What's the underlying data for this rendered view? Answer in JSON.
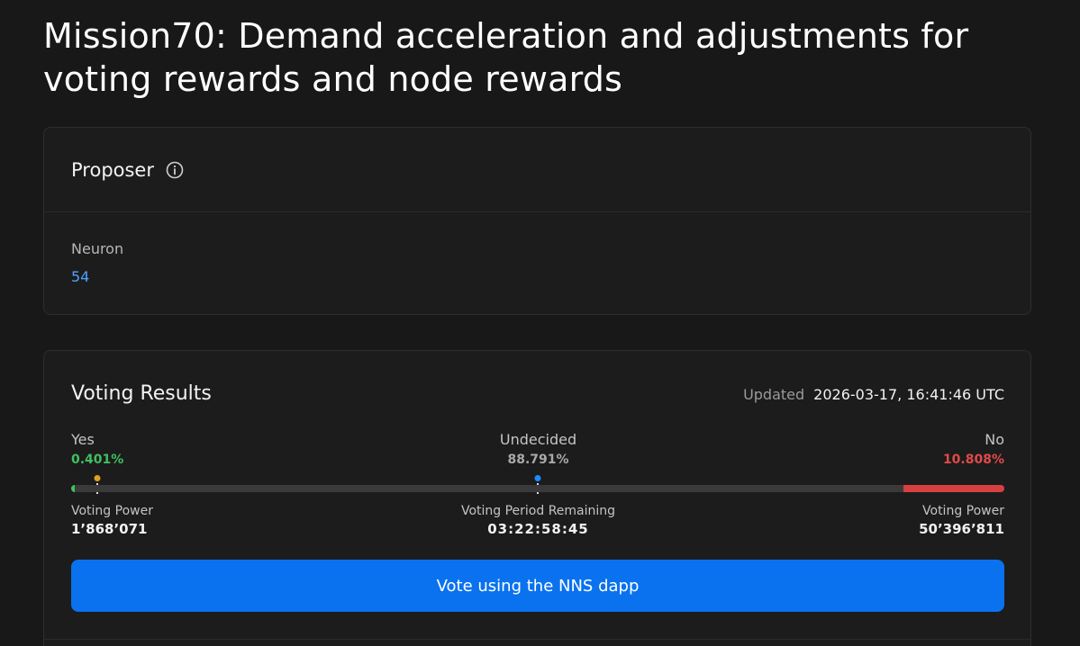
{
  "proposal": {
    "title": "Mission70: Demand acceleration and adjustments for voting rewards and node rewards"
  },
  "proposer": {
    "heading": "Proposer",
    "info_icon": "info-icon",
    "neuron_label": "Neuron",
    "neuron_id": "54"
  },
  "voting": {
    "heading": "Voting Results",
    "updated_label": "Updated",
    "updated_value": "2026-03-17, 16:41:46 UTC",
    "yes_label": "Yes",
    "yes_pct": "0.401%",
    "undecided_label": "Undecided",
    "undecided_pct": "88.791%",
    "no_label": "No",
    "no_pct": "10.808%",
    "yes_fraction": 0.00401,
    "no_fraction": 0.10808,
    "vp_yes_label": "Voting Power",
    "vp_yes_value": "1’868’071",
    "remaining_label": "Voting Period Remaining",
    "remaining_value": "03:22:58:45",
    "vp_no_label": "Voting Power",
    "vp_no_value": "50’396’811",
    "colors": {
      "yes": "#3fbf5f",
      "no": "#d64040",
      "undecided": "#3a3a3a",
      "threshold_marker": "#e0a020",
      "midpoint_marker": "#1a8cff"
    }
  },
  "actions": {
    "vote_button": "Vote using the NNS dapp"
  }
}
